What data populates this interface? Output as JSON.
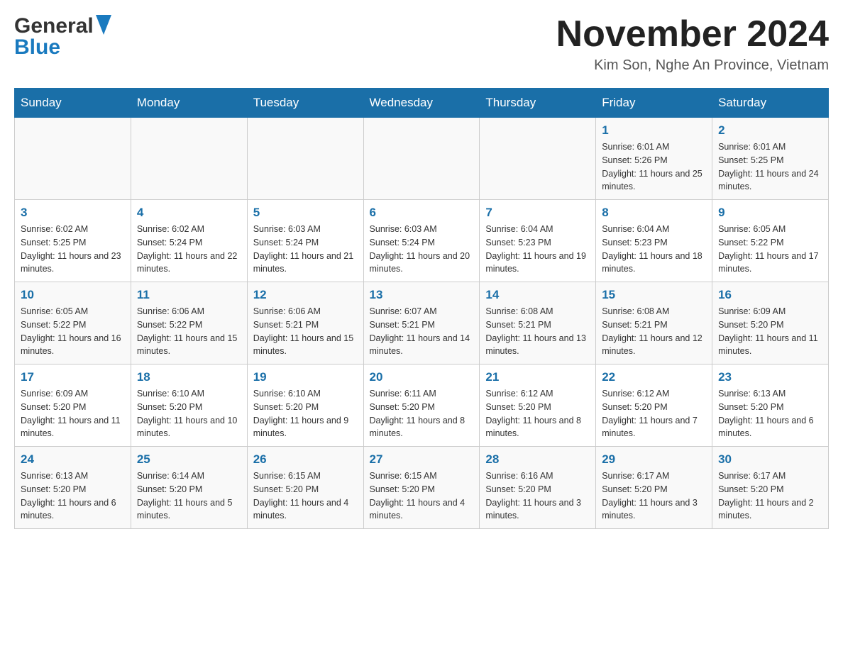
{
  "header": {
    "logo": {
      "general_text": "General",
      "blue_text": "Blue",
      "arrow_alt": "logo arrow"
    },
    "title": "November 2024",
    "location": "Kim Son, Nghe An Province, Vietnam"
  },
  "calendar": {
    "days_of_week": [
      "Sunday",
      "Monday",
      "Tuesday",
      "Wednesday",
      "Thursday",
      "Friday",
      "Saturday"
    ],
    "weeks": [
      {
        "days": [
          {
            "date": "",
            "info": ""
          },
          {
            "date": "",
            "info": ""
          },
          {
            "date": "",
            "info": ""
          },
          {
            "date": "",
            "info": ""
          },
          {
            "date": "",
            "info": ""
          },
          {
            "date": "1",
            "info": "Sunrise: 6:01 AM\nSunset: 5:26 PM\nDaylight: 11 hours and 25 minutes."
          },
          {
            "date": "2",
            "info": "Sunrise: 6:01 AM\nSunset: 5:25 PM\nDaylight: 11 hours and 24 minutes."
          }
        ]
      },
      {
        "days": [
          {
            "date": "3",
            "info": "Sunrise: 6:02 AM\nSunset: 5:25 PM\nDaylight: 11 hours and 23 minutes."
          },
          {
            "date": "4",
            "info": "Sunrise: 6:02 AM\nSunset: 5:24 PM\nDaylight: 11 hours and 22 minutes."
          },
          {
            "date": "5",
            "info": "Sunrise: 6:03 AM\nSunset: 5:24 PM\nDaylight: 11 hours and 21 minutes."
          },
          {
            "date": "6",
            "info": "Sunrise: 6:03 AM\nSunset: 5:24 PM\nDaylight: 11 hours and 20 minutes."
          },
          {
            "date": "7",
            "info": "Sunrise: 6:04 AM\nSunset: 5:23 PM\nDaylight: 11 hours and 19 minutes."
          },
          {
            "date": "8",
            "info": "Sunrise: 6:04 AM\nSunset: 5:23 PM\nDaylight: 11 hours and 18 minutes."
          },
          {
            "date": "9",
            "info": "Sunrise: 6:05 AM\nSunset: 5:22 PM\nDaylight: 11 hours and 17 minutes."
          }
        ]
      },
      {
        "days": [
          {
            "date": "10",
            "info": "Sunrise: 6:05 AM\nSunset: 5:22 PM\nDaylight: 11 hours and 16 minutes."
          },
          {
            "date": "11",
            "info": "Sunrise: 6:06 AM\nSunset: 5:22 PM\nDaylight: 11 hours and 15 minutes."
          },
          {
            "date": "12",
            "info": "Sunrise: 6:06 AM\nSunset: 5:21 PM\nDaylight: 11 hours and 15 minutes."
          },
          {
            "date": "13",
            "info": "Sunrise: 6:07 AM\nSunset: 5:21 PM\nDaylight: 11 hours and 14 minutes."
          },
          {
            "date": "14",
            "info": "Sunrise: 6:08 AM\nSunset: 5:21 PM\nDaylight: 11 hours and 13 minutes."
          },
          {
            "date": "15",
            "info": "Sunrise: 6:08 AM\nSunset: 5:21 PM\nDaylight: 11 hours and 12 minutes."
          },
          {
            "date": "16",
            "info": "Sunrise: 6:09 AM\nSunset: 5:20 PM\nDaylight: 11 hours and 11 minutes."
          }
        ]
      },
      {
        "days": [
          {
            "date": "17",
            "info": "Sunrise: 6:09 AM\nSunset: 5:20 PM\nDaylight: 11 hours and 11 minutes."
          },
          {
            "date": "18",
            "info": "Sunrise: 6:10 AM\nSunset: 5:20 PM\nDaylight: 11 hours and 10 minutes."
          },
          {
            "date": "19",
            "info": "Sunrise: 6:10 AM\nSunset: 5:20 PM\nDaylight: 11 hours and 9 minutes."
          },
          {
            "date": "20",
            "info": "Sunrise: 6:11 AM\nSunset: 5:20 PM\nDaylight: 11 hours and 8 minutes."
          },
          {
            "date": "21",
            "info": "Sunrise: 6:12 AM\nSunset: 5:20 PM\nDaylight: 11 hours and 8 minutes."
          },
          {
            "date": "22",
            "info": "Sunrise: 6:12 AM\nSunset: 5:20 PM\nDaylight: 11 hours and 7 minutes."
          },
          {
            "date": "23",
            "info": "Sunrise: 6:13 AM\nSunset: 5:20 PM\nDaylight: 11 hours and 6 minutes."
          }
        ]
      },
      {
        "days": [
          {
            "date": "24",
            "info": "Sunrise: 6:13 AM\nSunset: 5:20 PM\nDaylight: 11 hours and 6 minutes."
          },
          {
            "date": "25",
            "info": "Sunrise: 6:14 AM\nSunset: 5:20 PM\nDaylight: 11 hours and 5 minutes."
          },
          {
            "date": "26",
            "info": "Sunrise: 6:15 AM\nSunset: 5:20 PM\nDaylight: 11 hours and 4 minutes."
          },
          {
            "date": "27",
            "info": "Sunrise: 6:15 AM\nSunset: 5:20 PM\nDaylight: 11 hours and 4 minutes."
          },
          {
            "date": "28",
            "info": "Sunrise: 6:16 AM\nSunset: 5:20 PM\nDaylight: 11 hours and 3 minutes."
          },
          {
            "date": "29",
            "info": "Sunrise: 6:17 AM\nSunset: 5:20 PM\nDaylight: 11 hours and 3 minutes."
          },
          {
            "date": "30",
            "info": "Sunrise: 6:17 AM\nSunset: 5:20 PM\nDaylight: 11 hours and 2 minutes."
          }
        ]
      }
    ]
  }
}
